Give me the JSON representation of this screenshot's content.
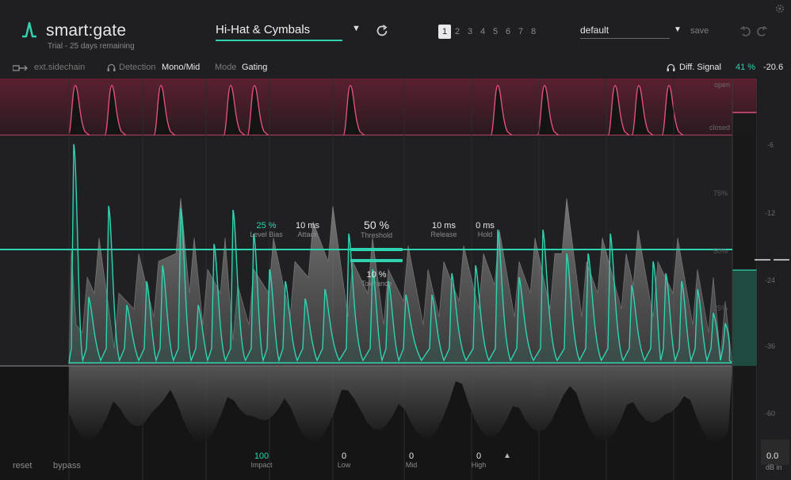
{
  "app": {
    "title": "smart:gate",
    "trial": "Trial - 25 days remaining"
  },
  "preset": {
    "name": "Hi-Hat & Cymbals"
  },
  "slots": [
    "1",
    "2",
    "3",
    "4",
    "5",
    "6",
    "7",
    "8"
  ],
  "active_slot": "1",
  "profile": {
    "name": "default",
    "save_label": "save"
  },
  "toolbar": {
    "sidechain": "ext.sidechain",
    "detection_label": "Detection",
    "detection_value": "Mono/Mid",
    "mode_label": "Mode",
    "mode_value": "Gating",
    "diff_label": "Diff. Signal",
    "diff_percent": "41 %",
    "diff_db": "-20.6"
  },
  "gate_lane": {
    "open": "open",
    "closed": "closed"
  },
  "params": {
    "level_bias": {
      "value": "25 %",
      "label": "Level Bias"
    },
    "attack": {
      "value": "10 ms",
      "label": "Attack"
    },
    "threshold": {
      "value": "50 %",
      "label": "Threshold"
    },
    "release": {
      "value": "10 ms",
      "label": "Release"
    },
    "hold": {
      "value": "0 ms",
      "label": "Hold"
    },
    "tolerance": {
      "value": "10 %",
      "label": "Tolerance"
    }
  },
  "percent_labels": [
    "75%",
    "50%",
    "25%"
  ],
  "db_scale": [
    "-6",
    "-12",
    "-24",
    "-36",
    "-60"
  ],
  "bottom": {
    "reset": "reset",
    "bypass": "bypass",
    "impact": {
      "value": "100",
      "label": "Impact"
    },
    "low": {
      "value": "0",
      "label": "Low"
    },
    "mid": {
      "value": "0",
      "label": "Mid"
    },
    "high": {
      "value": "0",
      "label": "High"
    },
    "db_in_value": "0.0",
    "db_in_label": "dB in"
  },
  "colors": {
    "accent": "#2fd3b0",
    "gate": "#e0507a"
  }
}
